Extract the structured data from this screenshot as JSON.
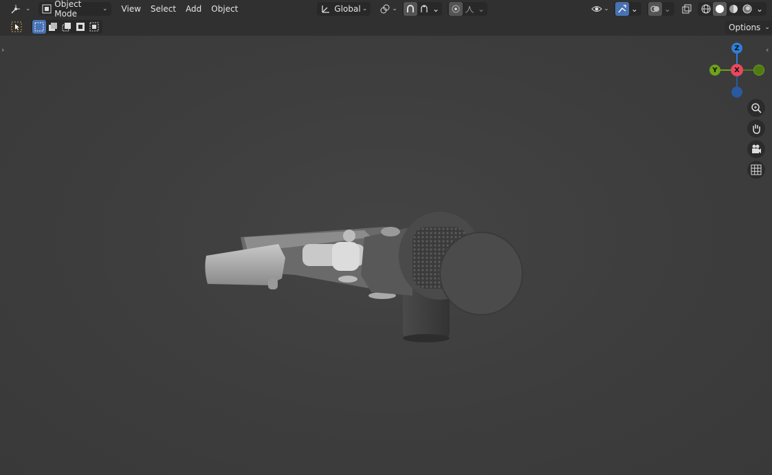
{
  "header": {
    "mode_label": "Object Mode",
    "menus": [
      "View",
      "Select",
      "Add",
      "Object"
    ],
    "transform_orientation": "Global",
    "icons": [
      "editor-type-icon",
      "object-mode-icon",
      "orientation-icon",
      "pivot-link-icon",
      "snap-icon",
      "snap-target-icon",
      "proportional-edit-icon",
      "falloff-icon",
      "visibility-icon",
      "gizmo-icon",
      "overlay-icon",
      "xray-icon",
      "wireframe-shading-icon",
      "solid-shading-icon",
      "material-shading-icon",
      "rendered-shading-icon"
    ]
  },
  "toolbar": {
    "options_label": "Options",
    "select_modes": [
      "set",
      "extend",
      "subtract",
      "difference",
      "intersect"
    ]
  },
  "gizmo": {
    "z_label": "Z",
    "y_label": "Y",
    "x_label": "X",
    "colors": {
      "x": "#e8485f",
      "y": "#6ea21a",
      "z": "#2f7ed8",
      "neg_y": "#4f7a14",
      "neg_z": "#295aa0"
    }
  },
  "nav_buttons": [
    "zoom-icon",
    "pan-hand-icon",
    "camera-icon",
    "ortho-grid-icon"
  ],
  "colors": {
    "accent": "#4772b3",
    "header_bg": "#303030",
    "viewport_bg": "#3d3d3d"
  }
}
